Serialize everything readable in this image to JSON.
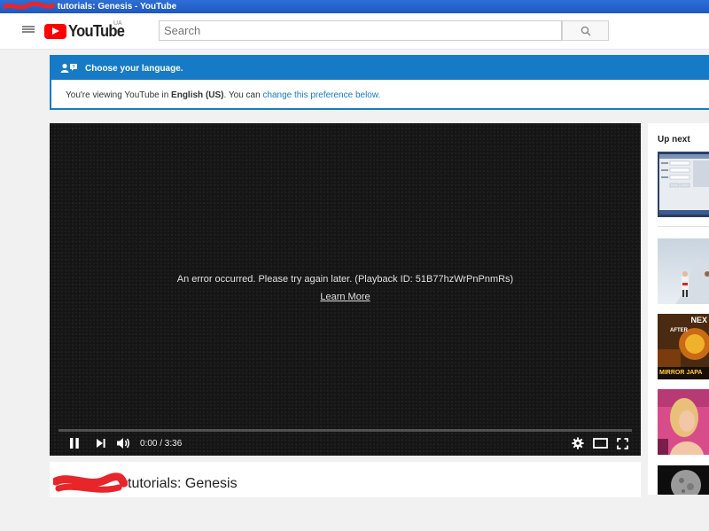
{
  "window": {
    "title": "tutorials: Genesis - YouTube"
  },
  "masthead": {
    "logo_text": "YouTube",
    "country_code": "UA",
    "search_placeholder": "Search"
  },
  "banner": {
    "heading": "Choose your language.",
    "body_prefix": "You're viewing YouTube in ",
    "language": "English (US)",
    "body_middle": ". You can ",
    "link_text": "change this preference below."
  },
  "player": {
    "error_message": "An error occurred. Please try again later. (Playback ID: 51B77hzWrPnPnmRs)",
    "learn_more": "Learn More",
    "time": "0:00 / 3:36",
    "progress_fraction": 0
  },
  "video": {
    "title": "tutorials: Genesis"
  },
  "sidebar": {
    "heading": "Up next",
    "thumbnails": [
      {
        "caption": ""
      },
      {
        "caption": ""
      },
      {
        "caption_top": "NEX",
        "caption_mid": "AFTER",
        "caption_bottom": "MIRROR JAPA"
      },
      {
        "caption": ""
      },
      {
        "caption": ""
      }
    ]
  },
  "colors": {
    "accent_blue": "#167ac6",
    "youtube_red": "#ff0000",
    "titlebar_blue": "#1f58c0",
    "redaction_red": "#e8262a"
  }
}
